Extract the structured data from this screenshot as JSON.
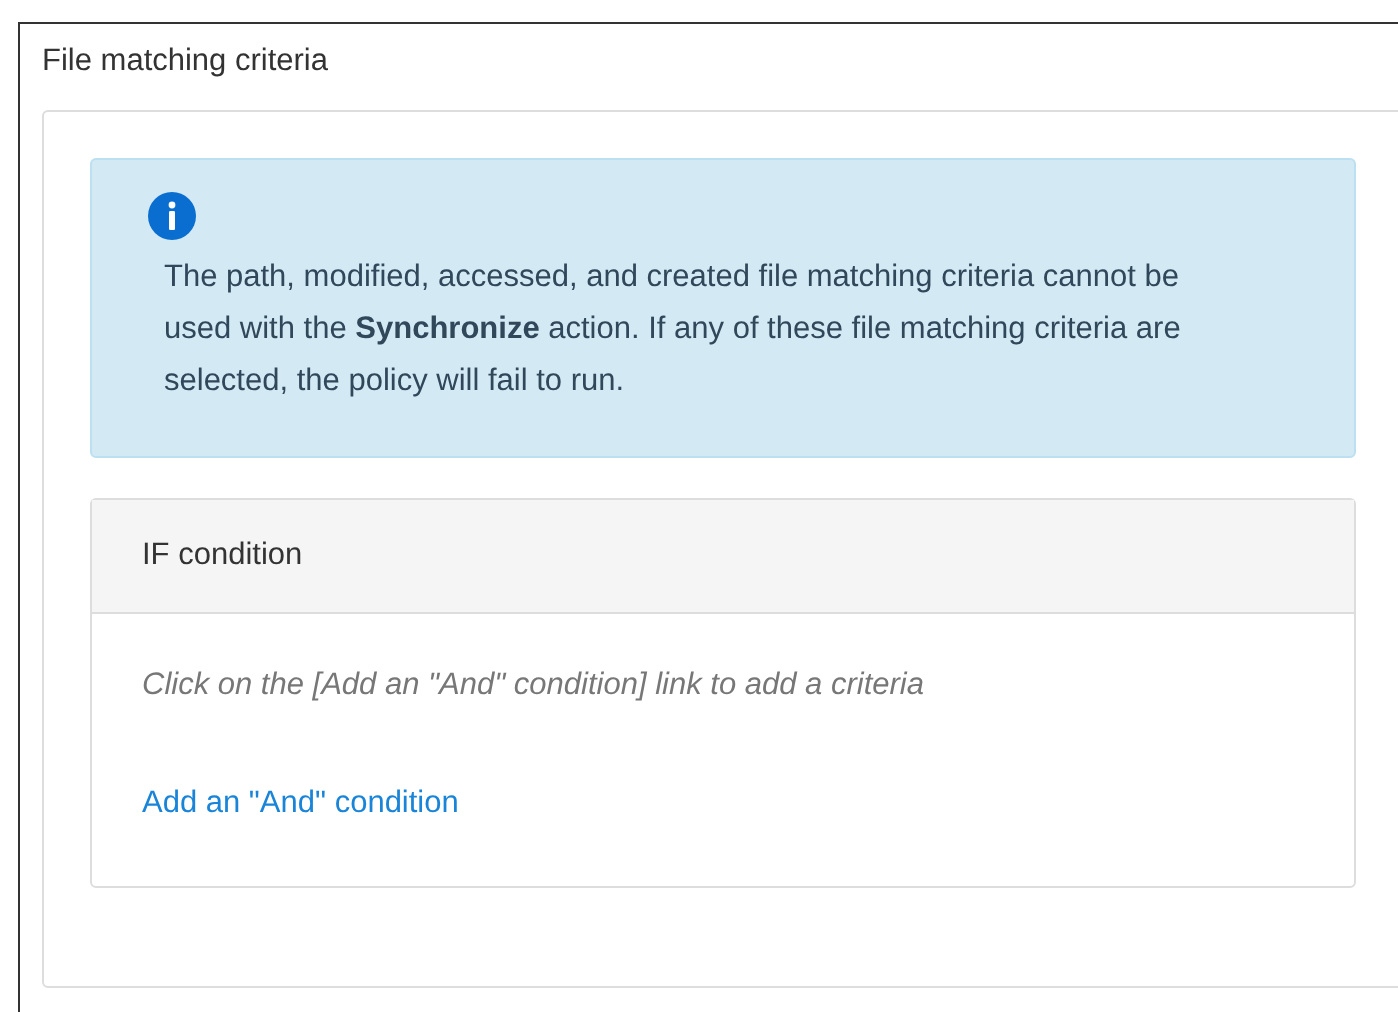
{
  "section": {
    "title": "File matching criteria"
  },
  "alert": {
    "message": "The path, modified, accessed, and created file matching criteria cannot be used with the **Synchronize** action. If any of these file matching criteria are selected, the policy will fail to run."
  },
  "condition_panel": {
    "header": "IF condition",
    "hint": "Click on the [Add an \"And\" condition] link to add a criteria",
    "link": "Add an \"And\" condition"
  }
}
